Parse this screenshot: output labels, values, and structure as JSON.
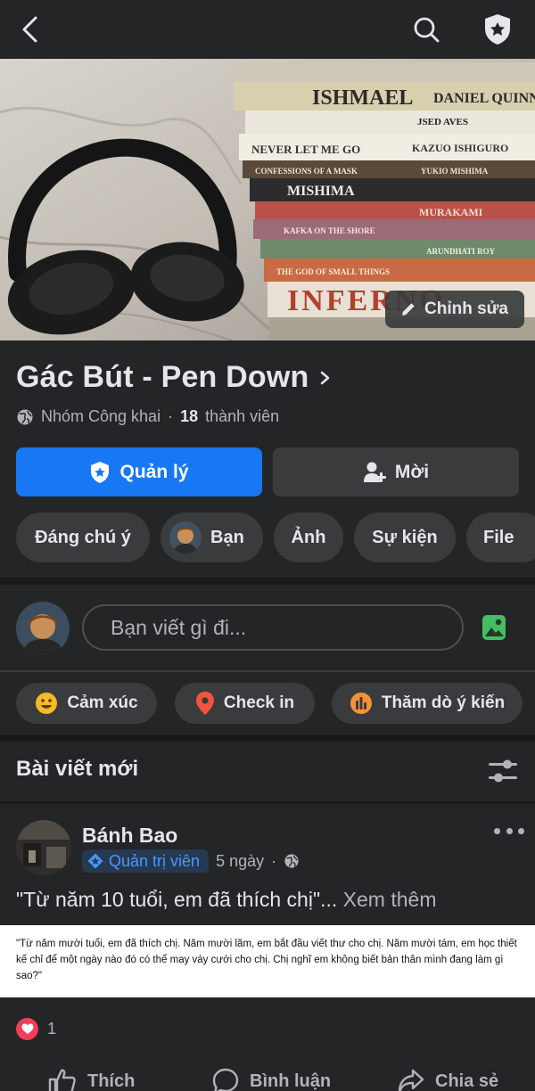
{
  "topbar": {
    "back_icon": "chevron-left-icon",
    "search_icon": "search-icon",
    "admin_icon": "shield-star-icon"
  },
  "cover": {
    "edit_label": "Chỉnh sửa",
    "book_spines": [
      "ISHMAEL",
      "DANIEL QUINN",
      "JSED AVES",
      "NEVER LET ME GO",
      "KAZUO ISHIGURO",
      "CONFESSIONS OF A MASK",
      "YUKIO MISHIMA",
      "MISHIMA",
      "MURAKAMI",
      "KAFKA ON THE SHORE",
      "ARUNDHATI ROY",
      "THE GOD OF SMALL THINGS",
      "INFERNO"
    ]
  },
  "group": {
    "name": "Gác Bút - Pen Down",
    "privacy": "Nhóm Công khai",
    "separator": "·",
    "member_count": "18",
    "member_label": "thành viên"
  },
  "buttons": {
    "manage": "Quản lý",
    "invite": "Mời"
  },
  "tabs": [
    {
      "label": "Đáng chú ý"
    },
    {
      "label": "Bạn"
    },
    {
      "label": "Ảnh"
    },
    {
      "label": "Sự kiện"
    },
    {
      "label": "File"
    }
  ],
  "composer": {
    "placeholder": "Bạn viết gì đi...",
    "photo_icon": "photo-icon"
  },
  "composer_actions": [
    {
      "label": "Cảm xúc",
      "icon": "smiley-icon",
      "color": "#f7b928"
    },
    {
      "label": "Check in",
      "icon": "location-pin-icon",
      "color": "#f5533d"
    },
    {
      "label": "Thăm dò ý kiến",
      "icon": "poll-icon",
      "color": "#f7923b"
    }
  ],
  "feed": {
    "section_title": "Bài viết mới",
    "filter_icon": "sliders-icon"
  },
  "post": {
    "author": "Bánh Bao",
    "badge": "Quản trị viên",
    "time": "5 ngày",
    "dot": "·",
    "text": "\"Từ năm 10 tuổi, em đã thích chị\"...",
    "see_more": "Xem thêm",
    "image_text": "\"Từ năm mười tuổi, em đã thích chị. Năm mười lăm, em bắt đầu viết thư cho chị. Năm mười tám, em học thiết kế chỉ để một ngày nào đó có thể may váy cưới cho chị. Chị nghĩ em không biết bản thân mình đang làm gì sao?\"",
    "reaction_count": "1",
    "actions": {
      "like": "Thích",
      "comment": "Bình luận",
      "share": "Chia sẻ"
    }
  },
  "colors": {
    "background": "#242526",
    "separator": "#18191a",
    "surface": "#3a3b3c",
    "primary": "#1877f2",
    "text": "#e4e6eb",
    "secondary_text": "#b0b3b8",
    "photo_green": "#45bd62",
    "heart": "#f33e58"
  }
}
